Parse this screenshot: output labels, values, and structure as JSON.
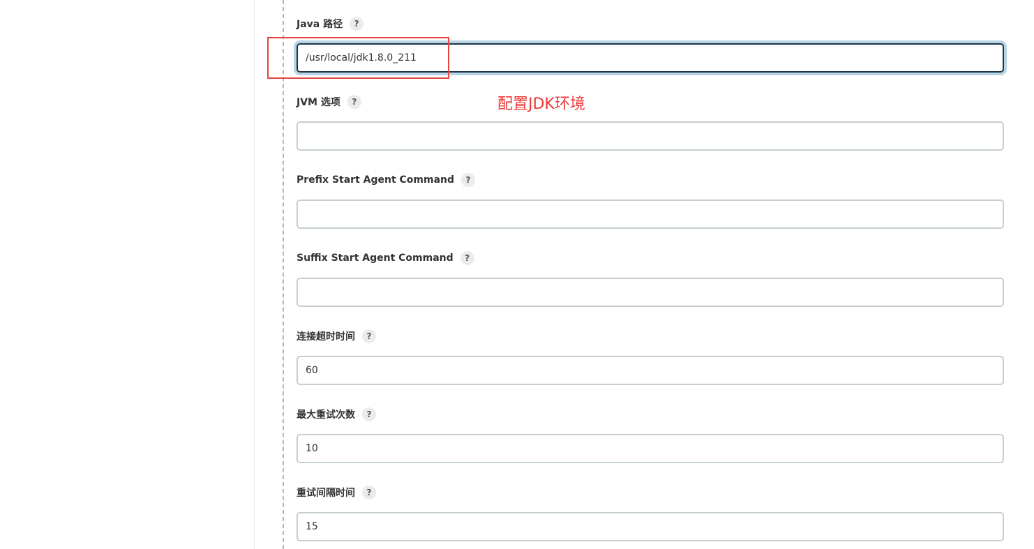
{
  "fields": [
    {
      "label": "Java 路径",
      "value": "/usr/local/jdk1.8.0_211",
      "placeholder": ""
    },
    {
      "label": "JVM 选项",
      "value": "",
      "placeholder": ""
    },
    {
      "label": "Prefix Start Agent Command",
      "value": "",
      "placeholder": ""
    },
    {
      "label": "Suffix Start Agent Command",
      "value": "",
      "placeholder": ""
    },
    {
      "label": "连接超时时间",
      "value": "60",
      "placeholder": ""
    },
    {
      "label": "最大重试次数",
      "value": "10",
      "placeholder": ""
    },
    {
      "label": "重试间隔时间",
      "value": "15",
      "placeholder": ""
    }
  ],
  "help_icon": {
    "glyph": "?",
    "name": "help-icon"
  },
  "annotation": {
    "text": "配置JDK环境",
    "color": "#ee3b3b"
  },
  "colors": {
    "focus_border": "#1e3445",
    "focus_ring": "#b9d4e4",
    "input_border": "#c5ced3",
    "annotation_box": "#e8433e"
  }
}
